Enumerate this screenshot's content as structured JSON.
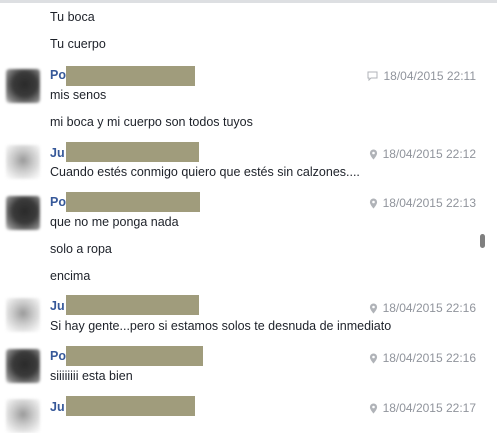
{
  "messages": [
    {
      "lines": [
        "Tu boca",
        "Tu cuerpo"
      ]
    },
    {
      "sender": "Po",
      "via": "chat",
      "time": "18/04/2015 22:11",
      "lines": [
        "mis senos",
        "mi boca y mi cuerpo son todos tuyos"
      ]
    },
    {
      "sender": "Ju",
      "via": "location",
      "time": "18/04/2015 22:12",
      "lines": [
        "Cuando estés conmigo quiero que estés sin calzones...."
      ]
    },
    {
      "sender": "Po",
      "via": "location",
      "time": "18/04/2015 22:13",
      "lines": [
        "que no me ponga nada",
        "solo a ropa",
        "encima"
      ]
    },
    {
      "sender": "Ju",
      "via": "location",
      "time": "18/04/2015 22:16",
      "lines": [
        "Si hay gente...pero si estamos solos te desnuda de inmediato"
      ]
    },
    {
      "sender": "Po",
      "via": "location",
      "time": "18/04/2015 22:16",
      "lines": [
        "siiiiiiii esta bien"
      ]
    },
    {
      "sender": "Ju",
      "via": "location",
      "time": "18/04/2015 22:17",
      "lines": []
    }
  ],
  "colors": {
    "sender": "#365899",
    "meta": "#90949c",
    "redaction": "#a09c7c"
  },
  "icons": {
    "chat": "chat-bubble-icon",
    "location": "location-pin-icon"
  }
}
